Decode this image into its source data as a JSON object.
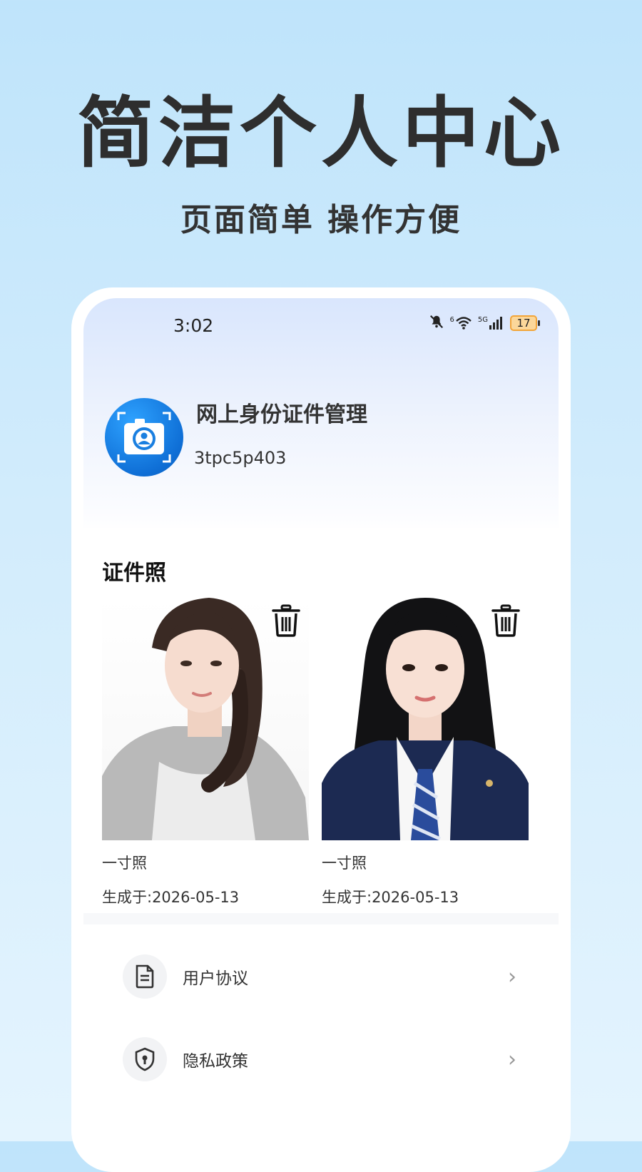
{
  "promo": {
    "headline": "简洁个人中心",
    "subline": "页面简单 操作方便"
  },
  "status_bar": {
    "time": "3:02",
    "network_small": "6",
    "network_type": "5G",
    "battery": "17"
  },
  "profile": {
    "app_name": "网上身份证件管理",
    "user_id": "3tpc5p403",
    "avatar_icon": "camera-portrait-icon"
  },
  "id_photos": {
    "title": "证件照",
    "items": [
      {
        "type": "一寸照",
        "date": "生成于:2026-05-13"
      },
      {
        "type": "一寸照",
        "date": "生成于:2026-05-13"
      }
    ]
  },
  "menu": {
    "items": [
      {
        "label": "用户协议",
        "icon": "document-icon"
      },
      {
        "label": "隐私政策",
        "icon": "shield-lock-icon"
      }
    ]
  },
  "colors": {
    "avatar_blue": "#0f6fd6",
    "battery_orange": "#f2a53a",
    "background": "#c9e8fb"
  }
}
